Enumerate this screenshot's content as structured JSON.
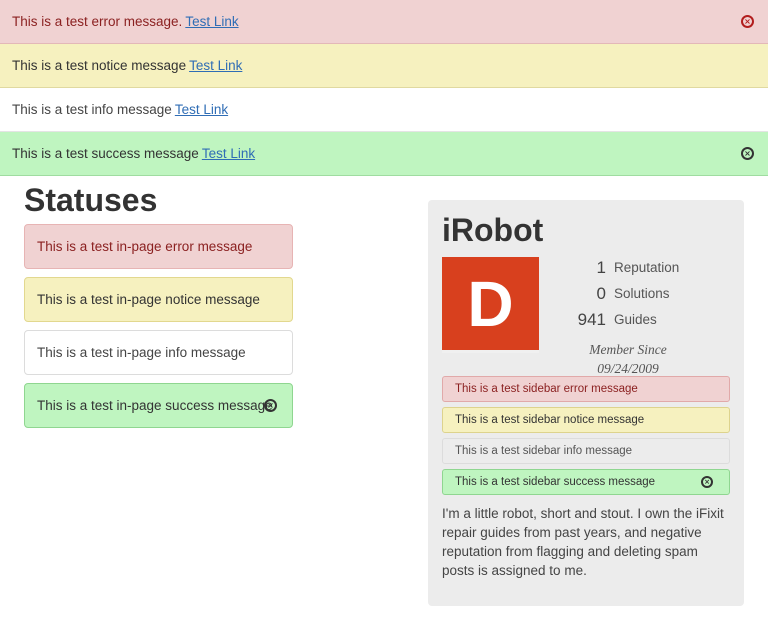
{
  "banners": {
    "error": {
      "text": "This is a test error message.",
      "link": "Test Link",
      "close_icon": "×"
    },
    "notice": {
      "text": "This is a test notice message",
      "link": "Test Link"
    },
    "info": {
      "text": "This is a test info message",
      "link": "Test Link"
    },
    "success": {
      "text": "This is a test success message",
      "link": "Test Link",
      "close_icon": "×"
    }
  },
  "main": {
    "heading": "Statuses",
    "messages": {
      "error": "This is a test in-page error message",
      "notice": "This is a test in-page notice message",
      "info": "This is a test in-page info message",
      "success": "This is a test in-page success message",
      "close_icon": "×"
    }
  },
  "sidebar": {
    "user_name": "iRobot",
    "avatar_letter": "D",
    "stats": [
      {
        "value": "1",
        "label": "Reputation"
      },
      {
        "value": "0",
        "label": "Solutions"
      },
      {
        "value": "941",
        "label": "Guides"
      }
    ],
    "member_since_label": "Member Since",
    "member_since_date": "09/24/2009",
    "messages": {
      "error": "This is a test sidebar error message",
      "notice": "This is a test sidebar notice message",
      "info": "This is a test sidebar info message",
      "success": "This is a test sidebar success message",
      "close_icon": "×"
    },
    "bio": "I'm a little robot, short and stout. I own the iFixit repair guides from past years, and negative reputation from flagging and deleting spam posts is assigned to me."
  },
  "colors": {
    "error_bg": "#f0d2d2",
    "error_text": "#8a1f1f",
    "notice_bg": "#f6f1bf",
    "success_bg": "#bff5c0",
    "link": "#2f6db5",
    "avatar_bg": "#d8401e",
    "sidebar_bg": "#ececec"
  }
}
